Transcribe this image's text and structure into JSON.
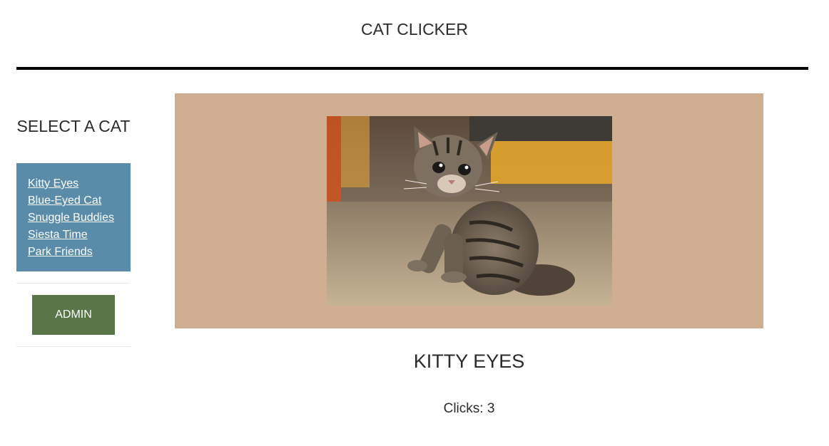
{
  "header": {
    "title": "CAT CLICKER"
  },
  "sidebar": {
    "title": "SELECT A CAT",
    "cats": [
      {
        "label": "Kitty Eyes"
      },
      {
        "label": "Blue-Eyed Cat"
      },
      {
        "label": "Snuggle Buddies"
      },
      {
        "label": "Siesta Time"
      },
      {
        "label": "Park Friends"
      }
    ],
    "admin_label": "ADMIN"
  },
  "main": {
    "cat_name": "KITTY EYES",
    "clicks_label": "Clicks:",
    "clicks": 3,
    "image_icon": "kitten-photo"
  },
  "colors": {
    "cat_list_bg": "#5a8ca9",
    "admin_button_bg": "#5a7548",
    "image_panel_bg": "#cfae92",
    "header_rule": "#000000"
  }
}
